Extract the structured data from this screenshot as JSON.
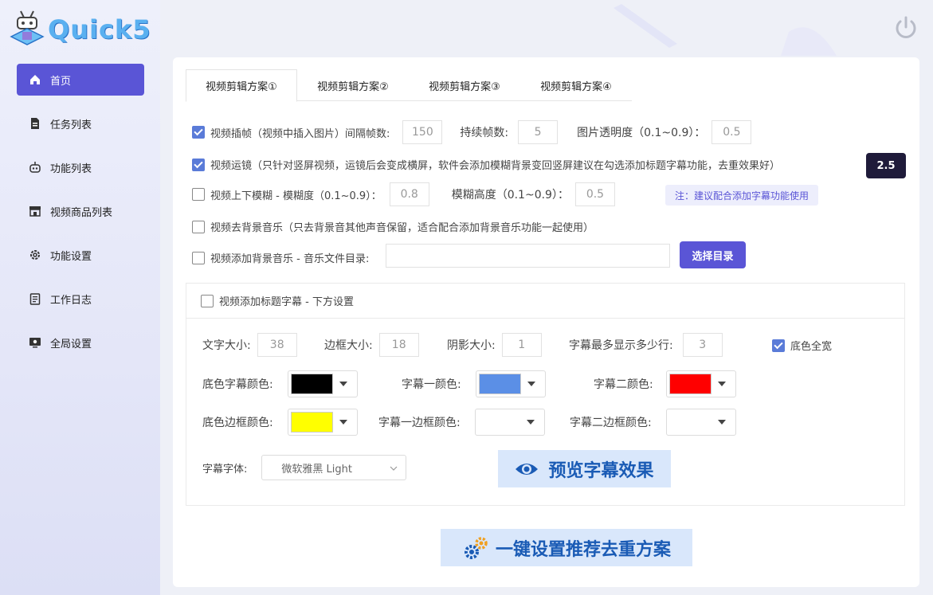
{
  "app": {
    "name": "Quick5"
  },
  "sidebar": {
    "items": [
      {
        "label": "首页",
        "icon": "home-icon",
        "active": true
      },
      {
        "label": "任务列表",
        "icon": "task-list-icon"
      },
      {
        "label": "功能列表",
        "icon": "robot-icon"
      },
      {
        "label": "视频商品列表",
        "icon": "store-icon"
      },
      {
        "label": "功能设置",
        "icon": "gear-icon"
      },
      {
        "label": "工作日志",
        "icon": "log-icon"
      },
      {
        "label": "全局设置",
        "icon": "monitor-settings-icon"
      }
    ]
  },
  "tabs": [
    {
      "label": "视频剪辑方案①",
      "active": true
    },
    {
      "label": "视频剪辑方案②"
    },
    {
      "label": "视频剪辑方案③"
    },
    {
      "label": "视频剪辑方案④"
    }
  ],
  "options": {
    "insert_frames": {
      "checked": true,
      "label": "视频插帧（视频中插入图片）间隔帧数:",
      "interval": "150",
      "duration_label": "持续帧数:",
      "duration": "5",
      "opacity_label": "图片透明度（0.1~0.9）：",
      "opacity": "0.5"
    },
    "camera_move": {
      "checked": true,
      "label": "视频运镜（只针对竖屏视频，运镜后会变成横屏，软件会添加模糊背景变回竖屏建议在勾选添加标题字幕功能，去重效果好）",
      "value": "2.5"
    },
    "blur": {
      "checked": false,
      "label": "视频上下模糊 - 模糊度（0.1~0.9）：",
      "blur_value": "0.8",
      "height_label": "模糊高度（0.1~0.9）：",
      "height_value": "0.5",
      "note": "注：建议配合添加字幕功能使用"
    },
    "remove_bgm": {
      "checked": false,
      "label": "视频去背景音乐（只去背景音其他声音保留，适合配合添加背景音乐功能一起使用）"
    },
    "add_bgm": {
      "checked": false,
      "label": "视频添加背景音乐 - 音乐文件目录:",
      "path": "",
      "button": "选择目录"
    }
  },
  "subtitle": {
    "checked": false,
    "header": "视频添加标题字幕 - 下方设置",
    "font_size_label": "文字大小:",
    "font_size": "38",
    "border_size_label": "边框大小:",
    "border_size": "18",
    "shadow_size_label": "阴影大小:",
    "shadow_size": "1",
    "max_lines_label": "字幕最多显示多少行:",
    "max_lines": "3",
    "full_width_label": "底色全宽",
    "full_width_checked": true,
    "bg_color_label": "底色字幕颜色:",
    "bg_color": "#000000",
    "sub1_color_label": "字幕一颜色:",
    "sub1_color": "#5b8fe6",
    "sub2_color_label": "字幕二颜色:",
    "sub2_color": "#ff0000",
    "bg_border_label": "底色边框颜色:",
    "bg_border_color": "#ffff00",
    "sub1_border_label": "字幕一边框颜色:",
    "sub1_border_color": "#ffffff",
    "sub2_border_label": "字幕二边框颜色:",
    "sub2_border_color": "#ffffff",
    "font_label": "字幕字体:",
    "font_value": "微软雅黑 Light",
    "preview_button": "预览字幕效果"
  },
  "oneclick_button": "一键设置推荐去重方案",
  "colors": {
    "accent": "#5a55d6",
    "button_bg": "#d9e7fb",
    "button_text": "#1a5bb5"
  }
}
